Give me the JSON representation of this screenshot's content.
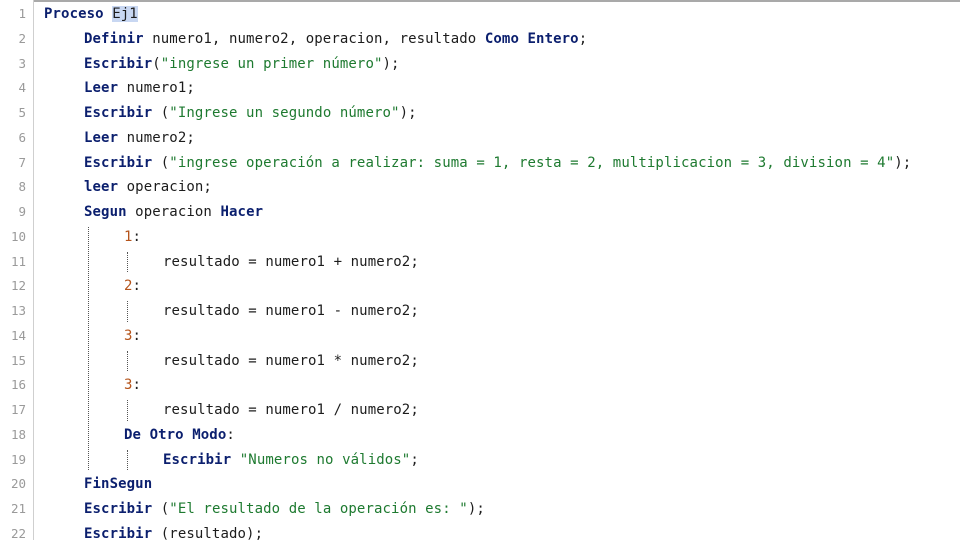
{
  "editor": {
    "lines": [
      {
        "n": "1",
        "indent": 44,
        "tokens": [
          {
            "t": "Proceso",
            "c": "kw"
          },
          {
            "t": " "
          },
          {
            "t": "Ej1",
            "c": "sel"
          }
        ]
      },
      {
        "n": "2",
        "indent": 84,
        "tokens": [
          {
            "t": "Definir",
            "c": "kw"
          },
          {
            "t": " numero1, numero2, operacion, resultado "
          },
          {
            "t": "Como",
            "c": "kw"
          },
          {
            "t": " "
          },
          {
            "t": "Entero",
            "c": "kw"
          },
          {
            "t": ";"
          }
        ]
      },
      {
        "n": "3",
        "indent": 84,
        "tokens": [
          {
            "t": "Escribir",
            "c": "kw"
          },
          {
            "t": "("
          },
          {
            "t": "\"ingrese un primer número\"",
            "c": "str"
          },
          {
            "t": ");"
          }
        ]
      },
      {
        "n": "4",
        "indent": 84,
        "tokens": [
          {
            "t": "Leer",
            "c": "kw"
          },
          {
            "t": " numero1;"
          }
        ]
      },
      {
        "n": "5",
        "indent": 84,
        "tokens": [
          {
            "t": "Escribir",
            "c": "kw"
          },
          {
            "t": " ("
          },
          {
            "t": "\"Ingrese un segundo número\"",
            "c": "str"
          },
          {
            "t": ");"
          }
        ]
      },
      {
        "n": "6",
        "indent": 84,
        "tokens": [
          {
            "t": "Leer",
            "c": "kw"
          },
          {
            "t": " numero2;"
          }
        ]
      },
      {
        "n": "7",
        "indent": 84,
        "tokens": [
          {
            "t": "Escribir",
            "c": "kw"
          },
          {
            "t": " ("
          },
          {
            "t": "\"ingrese operación a realizar: suma = 1, resta = 2, multiplicacion = 3, division = 4\"",
            "c": "str"
          },
          {
            "t": ");"
          }
        ]
      },
      {
        "n": "8",
        "indent": 84,
        "tokens": [
          {
            "t": "leer",
            "c": "kw"
          },
          {
            "t": " operacion;"
          }
        ]
      },
      {
        "n": "9",
        "indent": 84,
        "tokens": [
          {
            "t": "Segun",
            "c": "kw"
          },
          {
            "t": " operacion "
          },
          {
            "t": "Hacer",
            "c": "kw"
          }
        ]
      },
      {
        "n": "10",
        "indent": 124,
        "tokens": [
          {
            "t": "1",
            "c": "case"
          },
          {
            "t": ":"
          }
        ]
      },
      {
        "n": "11",
        "indent": 163,
        "tokens": [
          {
            "t": "resultado = numero1 + numero2;"
          }
        ]
      },
      {
        "n": "12",
        "indent": 124,
        "tokens": [
          {
            "t": "2",
            "c": "case"
          },
          {
            "t": ":"
          }
        ]
      },
      {
        "n": "13",
        "indent": 163,
        "tokens": [
          {
            "t": "resultado = numero1 - numero2;"
          }
        ]
      },
      {
        "n": "14",
        "indent": 124,
        "tokens": [
          {
            "t": "3",
            "c": "case"
          },
          {
            "t": ":"
          }
        ]
      },
      {
        "n": "15",
        "indent": 163,
        "tokens": [
          {
            "t": "resultado = numero1 * numero2;"
          }
        ]
      },
      {
        "n": "16",
        "indent": 124,
        "tokens": [
          {
            "t": "3",
            "c": "case"
          },
          {
            "t": ":"
          }
        ]
      },
      {
        "n": "17",
        "indent": 163,
        "tokens": [
          {
            "t": "resultado = numero1 / numero2;"
          }
        ]
      },
      {
        "n": "18",
        "indent": 124,
        "tokens": [
          {
            "t": "De",
            "c": "kw"
          },
          {
            "t": " "
          },
          {
            "t": "Otro",
            "c": "kw"
          },
          {
            "t": " "
          },
          {
            "t": "Modo",
            "c": "kw"
          },
          {
            "t": ":"
          }
        ]
      },
      {
        "n": "19",
        "indent": 163,
        "tokens": [
          {
            "t": "Escribir",
            "c": "kw"
          },
          {
            "t": " "
          },
          {
            "t": "\"Numeros no válidos\"",
            "c": "str"
          },
          {
            "t": ";"
          }
        ]
      },
      {
        "n": "20",
        "indent": 84,
        "tokens": [
          {
            "t": "FinSegun",
            "c": "kw"
          }
        ]
      },
      {
        "n": "21",
        "indent": 84,
        "tokens": [
          {
            "t": "Escribir",
            "c": "kw"
          },
          {
            "t": " ("
          },
          {
            "t": "\"El resultado de la operación es: \"",
            "c": "str"
          },
          {
            "t": ");"
          }
        ]
      },
      {
        "n": "22",
        "indent": 84,
        "tokens": [
          {
            "t": "Escribir",
            "c": "kw"
          },
          {
            "t": " (resultado);"
          }
        ]
      }
    ]
  }
}
